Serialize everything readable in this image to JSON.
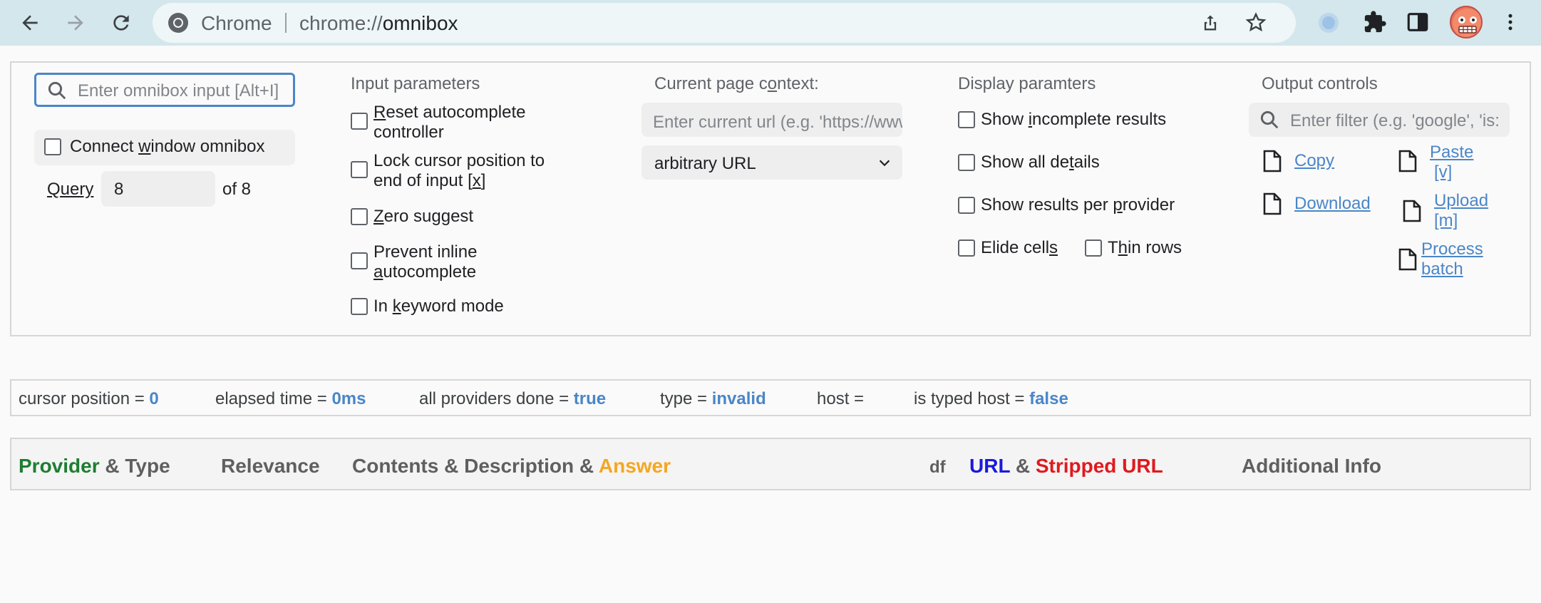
{
  "browser": {
    "omnibox_label": "Chrome",
    "url_scheme": "chrome://",
    "url_host": "omnibox"
  },
  "input_column": {
    "omnibox_placeholder": "Enter omnibox input [Alt+I]",
    "connect_label_pre": "Connect ",
    "connect_label_key": "w",
    "connect_label_post": "indow omnibox",
    "query_label": "Query",
    "query_value": "8",
    "query_of": "of 8"
  },
  "input_parameters": {
    "title": "Input parameters",
    "reset_line1_key": "R",
    "reset_line1_post": "eset autocomplete",
    "reset_line2": "controller",
    "lock_line1": "Lock cursor position to",
    "lock_line2_pre": "end of input [",
    "lock_line2_key": "x",
    "lock_line2_post": "]",
    "zero_key": "Z",
    "zero_post": "ero suggest",
    "prevent_line1": "Prevent inline",
    "prevent_line2_key": "a",
    "prevent_line2_post": "utocomplete",
    "keyword_pre": "In ",
    "keyword_key": "k",
    "keyword_post": "eyword mode"
  },
  "page_context": {
    "title_pre": "Current page c",
    "title_key": "o",
    "title_post": "ntext:",
    "url_placeholder": "Enter current url (e.g. 'https://www",
    "type_select": "arbitrary URL"
  },
  "display": {
    "title": "Display paramters",
    "incomplete_pre": "Show ",
    "incomplete_key": "i",
    "incomplete_post": "ncomplete results",
    "details_pre": "Show all de",
    "details_key": "t",
    "details_post": "ails",
    "per_provider_pre": "Show results per ",
    "per_provider_key": "p",
    "per_provider_post": "rovider",
    "elide_pre": "Elide cell",
    "elide_key": "s",
    "thin_pre": "T",
    "thin_key": "h",
    "thin_post": "in rows"
  },
  "output": {
    "title": "Output controls",
    "filter_placeholder": "Enter filter (e.g. 'google', 'is:",
    "copy": "Copy",
    "paste_line1": "Paste",
    "paste_line2": "[v]",
    "download": "Download",
    "upload_line1": "Upload",
    "upload_line2": "[m]",
    "process_line1": "Process",
    "process_line2": "batch"
  },
  "status": {
    "cursor_label": "cursor position = ",
    "cursor_value": "0",
    "elapsed_label": "elapsed time = ",
    "elapsed_value": "0ms",
    "providers_label": "all providers done = ",
    "providers_value": "true",
    "type_label": "type = ",
    "type_value": "invalid",
    "host_label": "host =",
    "typed_host_label": "is typed host = ",
    "typed_host_value": "false"
  },
  "results_header": {
    "provider": "Provider",
    "and_type": " & Type",
    "relevance": "Relevance",
    "contents": "Contents & Description & ",
    "answer": "Answer",
    "df": "df",
    "url": "URL",
    "amp": " & ",
    "stripped": "Stripped URL",
    "additional": "Additional Info"
  },
  "colors": {
    "link": "#4a86c8",
    "provider": "#1e7d32",
    "answer": "#f5a623",
    "url": "#1a1adc",
    "stripped": "#e0191e",
    "focus": "#4a86c8"
  }
}
